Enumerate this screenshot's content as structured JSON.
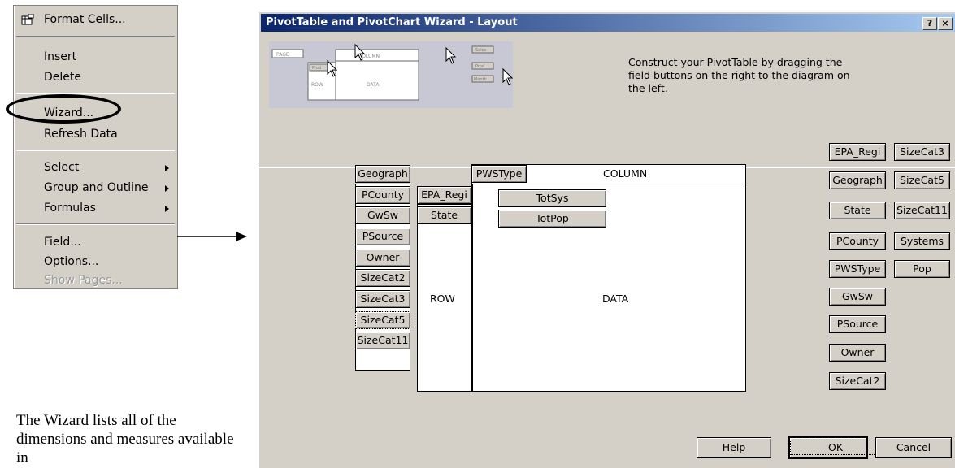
{
  "context_menu": {
    "items": [
      {
        "label": "Format Cells...",
        "enabled": true
      },
      {
        "label": "Insert",
        "enabled": true
      },
      {
        "label": "Delete",
        "enabled": true
      },
      {
        "label": "Wizard...",
        "enabled": true,
        "highlighted_by_oval": true
      },
      {
        "label": "Refresh Data",
        "enabled": true
      },
      {
        "label": "Select",
        "enabled": true,
        "submenu": true
      },
      {
        "label": "Group and Outline",
        "enabled": true,
        "submenu": true
      },
      {
        "label": "Formulas",
        "enabled": true,
        "submenu": true
      },
      {
        "label": "Field...",
        "enabled": true
      },
      {
        "label": "Options...",
        "enabled": true
      },
      {
        "label": "Show Pages...",
        "enabled": false
      }
    ]
  },
  "caption": "The Wizard lists all of the dimensions and measures available in",
  "dialog": {
    "title": "PivotTable and PivotChart Wizard - Layout",
    "help_glyph": "?",
    "close_glyph": "×",
    "instructions": "Construct your PivotTable by dragging the field buttons on the right to the diagram on the left.",
    "preview": {
      "page": "PAGE",
      "column": "COLUMN",
      "row": "ROW",
      "data": "DATA",
      "b1": "Prod",
      "b2": "Sales",
      "b3": "Prod",
      "b4": "Month"
    },
    "page_fields": [
      "Geograph",
      "PCounty",
      "GwSw",
      "PSource",
      "Owner",
      "SizeCat2",
      "SizeCat3",
      "SizeCat5",
      "SizeCat11"
    ],
    "row_fields": [
      "EPA_Regi",
      "State"
    ],
    "column_field": "PWSType",
    "column_label": "COLUMN",
    "row_label": "ROW",
    "data_label": "DATA",
    "data_fields": [
      "TotSys",
      "TotPop"
    ],
    "field_list_left": [
      "EPA_Regi",
      "Geograph",
      "State",
      "PCounty",
      "PWSType",
      "GwSw",
      "PSource",
      "Owner",
      "SizeCat2"
    ],
    "field_list_right": [
      "SizeCat3",
      "SizeCat5",
      "SizeCat11",
      "Systems",
      "Pop"
    ],
    "buttons": {
      "help": "Help",
      "ok": "OK",
      "cancel": "Cancel"
    }
  }
}
